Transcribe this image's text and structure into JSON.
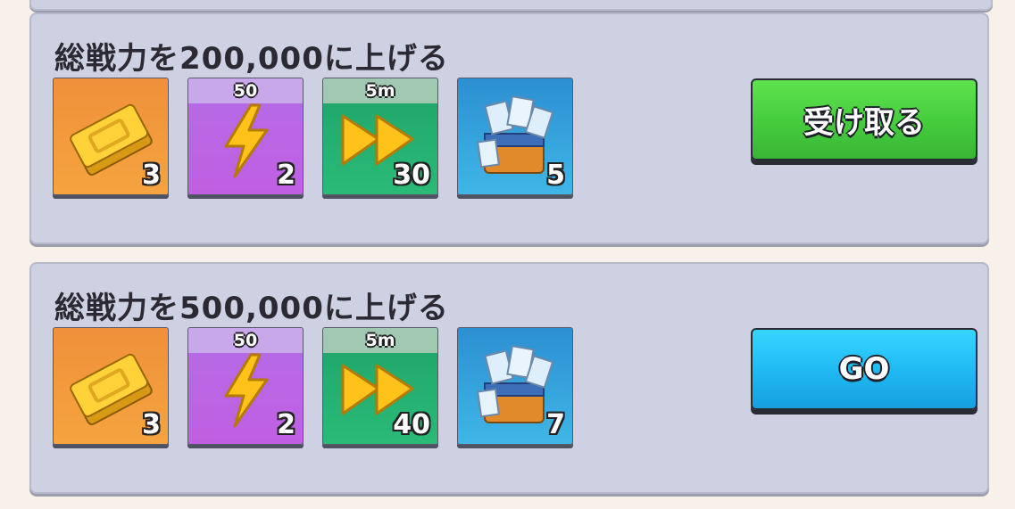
{
  "quests": [
    {
      "title": "総戦力を200,000に上げる",
      "rewards": [
        {
          "icon": "ticket-icon",
          "quantity": "3",
          "banner": ""
        },
        {
          "icon": "lightning-icon",
          "quantity": "2",
          "banner": "50"
        },
        {
          "icon": "fast-forward-icon",
          "quantity": "30",
          "banner": "5m"
        },
        {
          "icon": "exp-chest-icon",
          "quantity": "5",
          "banner": ""
        }
      ],
      "button": {
        "label": "受け取る",
        "color": "#45cc3c"
      }
    },
    {
      "title": "総戦力を500,000に上げる",
      "rewards": [
        {
          "icon": "ticket-icon",
          "quantity": "3",
          "banner": ""
        },
        {
          "icon": "lightning-icon",
          "quantity": "2",
          "banner": "50"
        },
        {
          "icon": "fast-forward-icon",
          "quantity": "40",
          "banner": "5m"
        },
        {
          "icon": "exp-chest-icon",
          "quantity": "7",
          "banner": ""
        }
      ],
      "button": {
        "label": "GO",
        "color": "#1fb8f3"
      }
    }
  ],
  "colors": {
    "card_bg": "#cdd1e2",
    "page_bg": "#f7f1ea"
  }
}
